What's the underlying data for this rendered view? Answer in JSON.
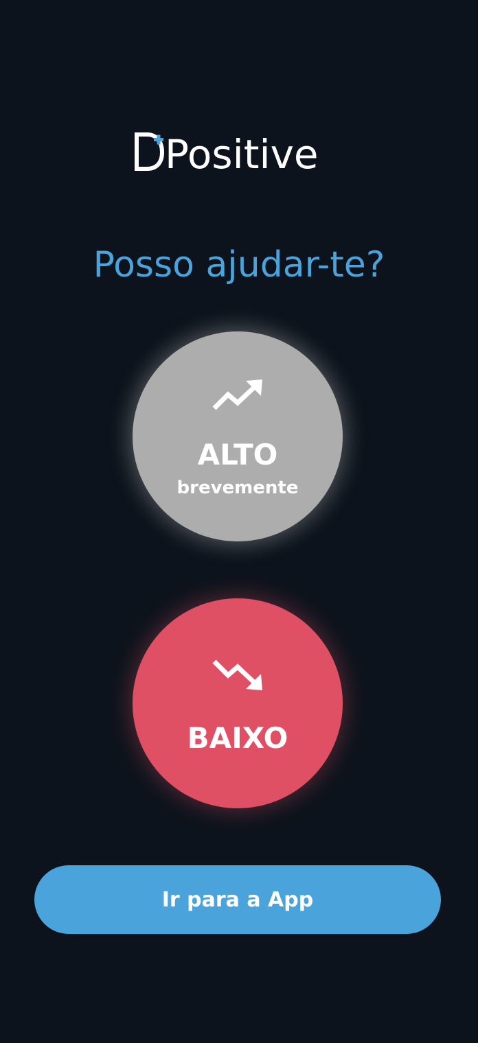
{
  "logo": {
    "text": "Positive",
    "accent_color": "#4aa3db",
    "icon": "d-cross-logo-icon"
  },
  "title": "Posso ajudar-te?",
  "options": {
    "high": {
      "label": "ALTO",
      "sublabel": "brevemente",
      "icon": "trending-up-icon",
      "color": "#adadad"
    },
    "low": {
      "label": "BAIXO",
      "icon": "trending-down-icon",
      "color": "#e05064"
    }
  },
  "footer": {
    "app_button_label": "Ir para a App",
    "button_color": "#4aa3db"
  },
  "colors": {
    "background": "#0d131c",
    "text": "#ffffff"
  }
}
